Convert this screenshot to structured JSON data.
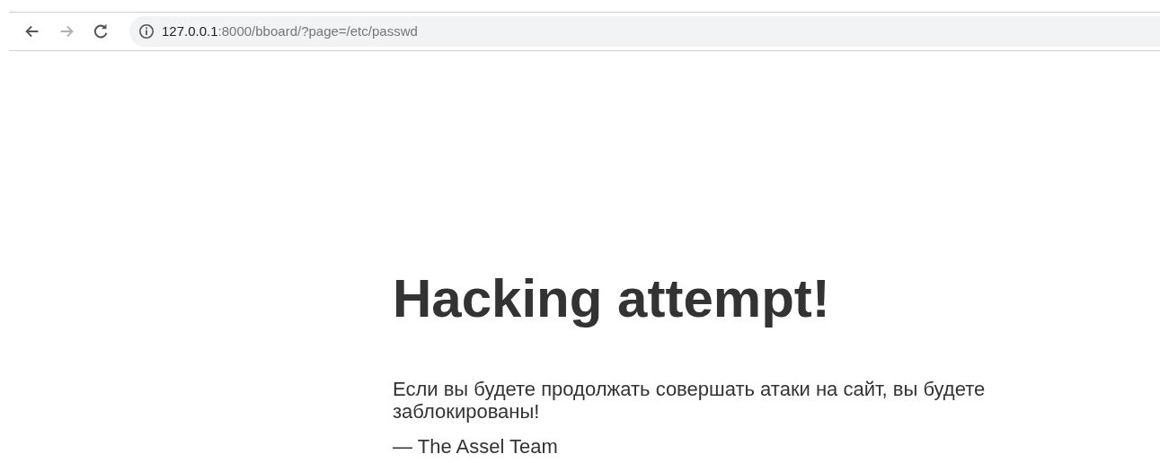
{
  "toolbar": {
    "buttons": [
      {
        "kind": "back",
        "disabled": false
      },
      {
        "kind": "forward",
        "disabled": true
      },
      {
        "kind": "reload",
        "disabled": false
      }
    ],
    "address": {
      "host": "127.0.0.1",
      "rest": ":8000/bboard/?page=/etc/passwd"
    }
  },
  "page": {
    "heading": "Hacking attempt!",
    "message": "Если вы будете продолжать совершать атаки на сайт, вы будете заблокированы!",
    "signature": "— The Assel Team"
  }
}
